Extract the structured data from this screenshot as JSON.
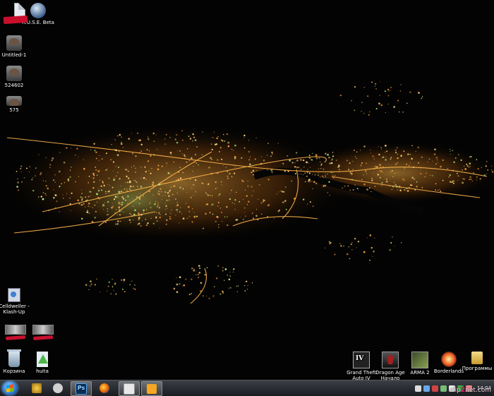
{
  "desktop": {
    "left_icons": [
      {
        "label": "",
        "icon": "file-icon"
      },
      {
        "label": "R.U.S.E. Beta",
        "icon": "ruse-game-icon"
      },
      {
        "label": "",
        "icon": "redacted-file-icon"
      },
      {
        "label": "Untitled-1",
        "icon": "psd-file-icon"
      },
      {
        "label": "524602",
        "icon": "psd-file-icon"
      },
      {
        "label": "575",
        "icon": "psd-file-icon"
      },
      {
        "label": "Celldweller -\nKlash-Up",
        "icon": "audio-shortcut-icon"
      },
      {
        "label": "",
        "icon": "redacted-thumbnail-icon"
      },
      {
        "label": "",
        "icon": "redacted-thumbnail-icon"
      },
      {
        "label": "Корзина",
        "icon": "recycle-bin-icon"
      },
      {
        "label": "huita",
        "icon": "huita-icon"
      }
    ],
    "right_icons": [
      {
        "label": "Grand Theft\nAuto IV",
        "icon": "gta-iv-icon"
      },
      {
        "label": "Dragon Age\nНачало",
        "icon": "dragon-age-icon"
      },
      {
        "label": "ARMA 2",
        "icon": "arma2-icon"
      },
      {
        "label": "Borderlands",
        "icon": "borderlands-icon"
      },
      {
        "label": "Программы",
        "icon": "programs-folder-icon"
      }
    ]
  },
  "taskbar": {
    "pinned": [
      {
        "name": "wow-icon",
        "active": false
      },
      {
        "name": "steam-icon",
        "active": false
      },
      {
        "name": "photoshop-icon",
        "active": true,
        "glyph_text": "Ps"
      },
      {
        "name": "firefox-icon",
        "active": false
      },
      {
        "name": "document-icon",
        "active": true
      },
      {
        "name": "media-player-icon",
        "active": true
      }
    ],
    "clock": {
      "time": "14:04",
      "date": ""
    },
    "watermark": {
      "prefix": "clip",
      "accent": "2",
      "suffix": "net.com"
    }
  },
  "colors": {
    "desktop_bg": "#000000",
    "city_lights": "#f6a23a",
    "taskbar_top": "#3b3f45"
  }
}
